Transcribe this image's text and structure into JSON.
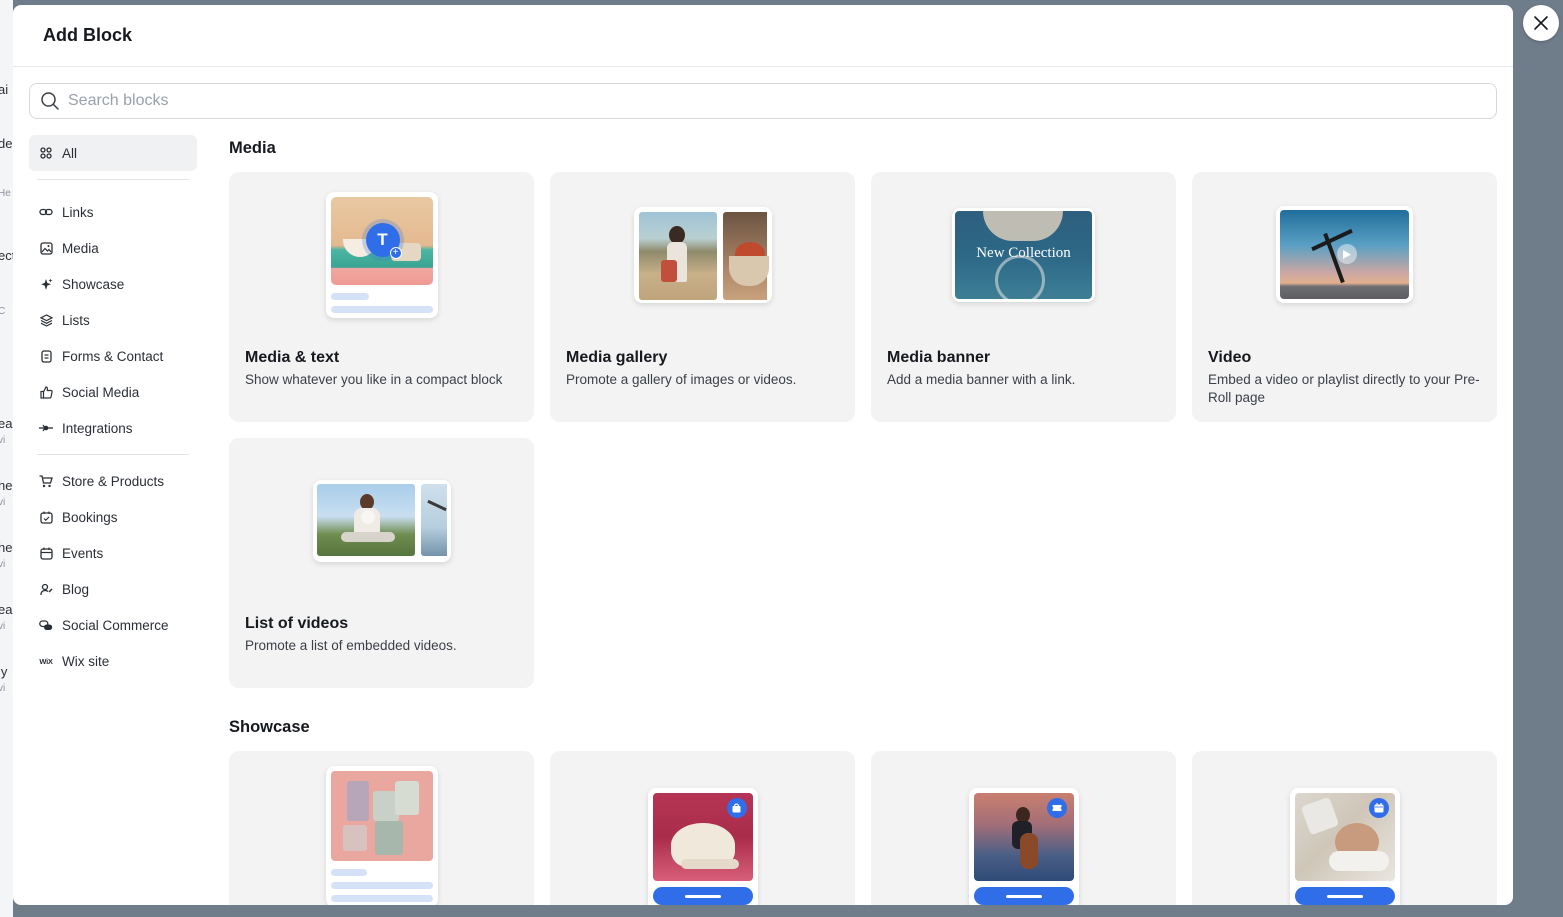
{
  "modal": {
    "title": "Add Block"
  },
  "search": {
    "placeholder": "Search blocks"
  },
  "background_page": {
    "fragments": [
      "ai",
      "de",
      "He",
      "ect",
      "C",
      "ea",
      "vi",
      "he",
      "vi",
      "he",
      "vi",
      "ea",
      "vi",
      "ly",
      "vi"
    ]
  },
  "sidebar": {
    "groups": [
      [
        {
          "label": "All",
          "icon": "grid-icon",
          "active": true
        }
      ],
      [
        {
          "label": "Links",
          "icon": "link-icon"
        },
        {
          "label": "Media",
          "icon": "image-icon"
        },
        {
          "label": "Showcase",
          "icon": "sparkle-icon"
        },
        {
          "label": "Lists",
          "icon": "layers-icon"
        },
        {
          "label": "Forms & Contact",
          "icon": "form-icon"
        },
        {
          "label": "Social Media",
          "icon": "thumbs-up-icon"
        },
        {
          "label": "Integrations",
          "icon": "integration-icon"
        }
      ],
      [
        {
          "label": "Store & Products",
          "icon": "cart-icon"
        },
        {
          "label": "Bookings",
          "icon": "calendar-check-icon"
        },
        {
          "label": "Events",
          "icon": "calendar-icon"
        },
        {
          "label": "Blog",
          "icon": "blog-icon"
        },
        {
          "label": "Social Commerce",
          "icon": "social-commerce-icon"
        },
        {
          "label": "Wix site",
          "icon": "wix-icon"
        }
      ]
    ]
  },
  "sections": [
    {
      "title": "Media",
      "cards": [
        {
          "title": "Media & text",
          "description": "Show whatever you like in a compact block",
          "thumb": "media-text"
        },
        {
          "title": "Media gallery",
          "description": "Promote a gallery of images or videos.",
          "thumb": "gallery"
        },
        {
          "title": "Media banner",
          "description": "Add a media banner with a link.",
          "thumb": "banner",
          "overlay_text": "New Collection"
        },
        {
          "title": "Video",
          "description": "Embed a video or playlist directly to your Pre-Roll page",
          "thumb": "video"
        },
        {
          "title": "List of videos",
          "description": "Promote a list of embedded videos.",
          "thumb": "video-list"
        }
      ]
    },
    {
      "title": "Showcase",
      "cards": [
        {
          "title": "",
          "thumb": "candles"
        },
        {
          "title": "",
          "thumb": "product"
        },
        {
          "title": "",
          "thumb": "event"
        },
        {
          "title": "",
          "thumb": "service"
        }
      ]
    }
  ],
  "colors": {
    "accent": "#2f6ee8",
    "card_bg": "#f3f3f3",
    "overlay": "#6f7c8a"
  }
}
